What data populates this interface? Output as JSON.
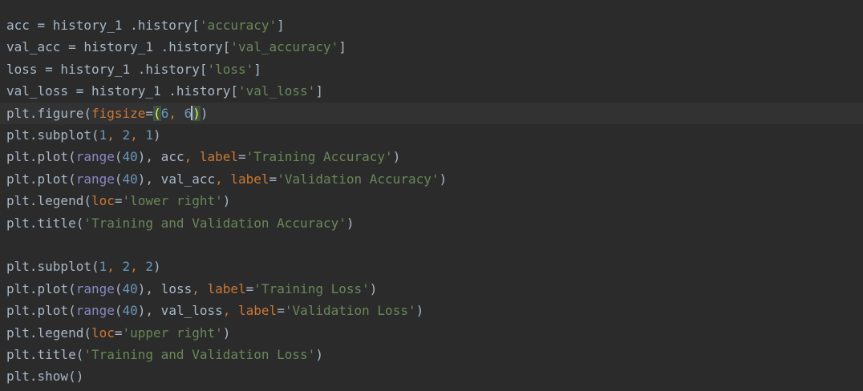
{
  "editor": {
    "colors": {
      "background": "#2b2b2b",
      "current_line": "#323232",
      "plain": "#a9b7c6",
      "string": "#6a8759",
      "number": "#6897bb",
      "keyword_arg": "#cc7832",
      "builtin": "#8888c6"
    },
    "lines": [
      {
        "tokens": [
          [
            "acc = history_1 .history[",
            "plain"
          ],
          [
            "'accuracy'",
            "str"
          ],
          [
            "]",
            "plain"
          ]
        ]
      },
      {
        "tokens": [
          [
            "val_acc = history_1 .history[",
            "plain"
          ],
          [
            "'val_accuracy'",
            "str"
          ],
          [
            "]",
            "plain"
          ]
        ]
      },
      {
        "tokens": [
          [
            "loss = history_1 .history[",
            "plain"
          ],
          [
            "'loss'",
            "str"
          ],
          [
            "]",
            "plain"
          ]
        ]
      },
      {
        "tokens": [
          [
            "val_loss = history_1 .history[",
            "plain"
          ],
          [
            "'val_loss'",
            "str"
          ],
          [
            "]",
            "plain"
          ]
        ]
      },
      {
        "current": true,
        "tokens": [
          [
            "plt.figure(",
            "plain"
          ],
          [
            "figsize",
            "kw"
          ],
          [
            "=",
            "plain"
          ],
          [
            "(",
            "bracket-hl"
          ],
          [
            "6",
            "num"
          ],
          [
            ", ",
            "kw"
          ],
          [
            "6",
            "num"
          ],
          [
            "|",
            "caret"
          ],
          [
            ")",
            "bracket-hl"
          ],
          [
            ")",
            "plain"
          ]
        ]
      },
      {
        "tokens": [
          [
            "plt.subplot(",
            "plain"
          ],
          [
            "1",
            "num"
          ],
          [
            ", ",
            "kw"
          ],
          [
            "2",
            "num"
          ],
          [
            ", ",
            "kw"
          ],
          [
            "1",
            "num"
          ],
          [
            ")",
            "plain"
          ]
        ]
      },
      {
        "tokens": [
          [
            "plt.plot(",
            "plain"
          ],
          [
            "range",
            "builtin"
          ],
          [
            "(",
            "plain"
          ],
          [
            "40",
            "num"
          ],
          [
            "), acc",
            "plain"
          ],
          [
            ", ",
            "kw"
          ],
          [
            "label",
            "kw"
          ],
          [
            "=",
            "plain"
          ],
          [
            "'Training Accuracy'",
            "str"
          ],
          [
            ")",
            "plain"
          ]
        ]
      },
      {
        "tokens": [
          [
            "plt.plot(",
            "plain"
          ],
          [
            "range",
            "builtin"
          ],
          [
            "(",
            "plain"
          ],
          [
            "40",
            "num"
          ],
          [
            "), val_acc",
            "plain"
          ],
          [
            ", ",
            "kw"
          ],
          [
            "label",
            "kw"
          ],
          [
            "=",
            "plain"
          ],
          [
            "'Validation Accuracy'",
            "str"
          ],
          [
            ")",
            "plain"
          ]
        ]
      },
      {
        "tokens": [
          [
            "plt.legend(",
            "plain"
          ],
          [
            "loc",
            "kw"
          ],
          [
            "=",
            "plain"
          ],
          [
            "'lower right'",
            "str"
          ],
          [
            ")",
            "plain"
          ]
        ]
      },
      {
        "tokens": [
          [
            "plt.title(",
            "plain"
          ],
          [
            "'Training and Validation Accuracy'",
            "str"
          ],
          [
            ")",
            "plain"
          ]
        ]
      },
      {
        "tokens": []
      },
      {
        "tokens": [
          [
            "plt.subplot(",
            "plain"
          ],
          [
            "1",
            "num"
          ],
          [
            ", ",
            "kw"
          ],
          [
            "2",
            "num"
          ],
          [
            ", ",
            "kw"
          ],
          [
            "2",
            "num"
          ],
          [
            ")",
            "plain"
          ]
        ]
      },
      {
        "tokens": [
          [
            "plt.plot(",
            "plain"
          ],
          [
            "range",
            "builtin"
          ],
          [
            "(",
            "plain"
          ],
          [
            "40",
            "num"
          ],
          [
            "), loss",
            "plain"
          ],
          [
            ", ",
            "kw"
          ],
          [
            "label",
            "kw"
          ],
          [
            "=",
            "plain"
          ],
          [
            "'Training Loss'",
            "str"
          ],
          [
            ")",
            "plain"
          ]
        ]
      },
      {
        "tokens": [
          [
            "plt.plot(",
            "plain"
          ],
          [
            "range",
            "builtin"
          ],
          [
            "(",
            "plain"
          ],
          [
            "40",
            "num"
          ],
          [
            "), val_loss",
            "plain"
          ],
          [
            ", ",
            "kw"
          ],
          [
            "label",
            "kw"
          ],
          [
            "=",
            "plain"
          ],
          [
            "'Validation Loss'",
            "str"
          ],
          [
            ")",
            "plain"
          ]
        ]
      },
      {
        "tokens": [
          [
            "plt.legend(",
            "plain"
          ],
          [
            "loc",
            "kw"
          ],
          [
            "=",
            "plain"
          ],
          [
            "'upper right'",
            "str"
          ],
          [
            ")",
            "plain"
          ]
        ]
      },
      {
        "tokens": [
          [
            "plt.title(",
            "plain"
          ],
          [
            "'Training and Validation Loss'",
            "str"
          ],
          [
            ")",
            "plain"
          ]
        ]
      },
      {
        "tokens": [
          [
            "plt.show()",
            "plain"
          ]
        ]
      }
    ]
  }
}
